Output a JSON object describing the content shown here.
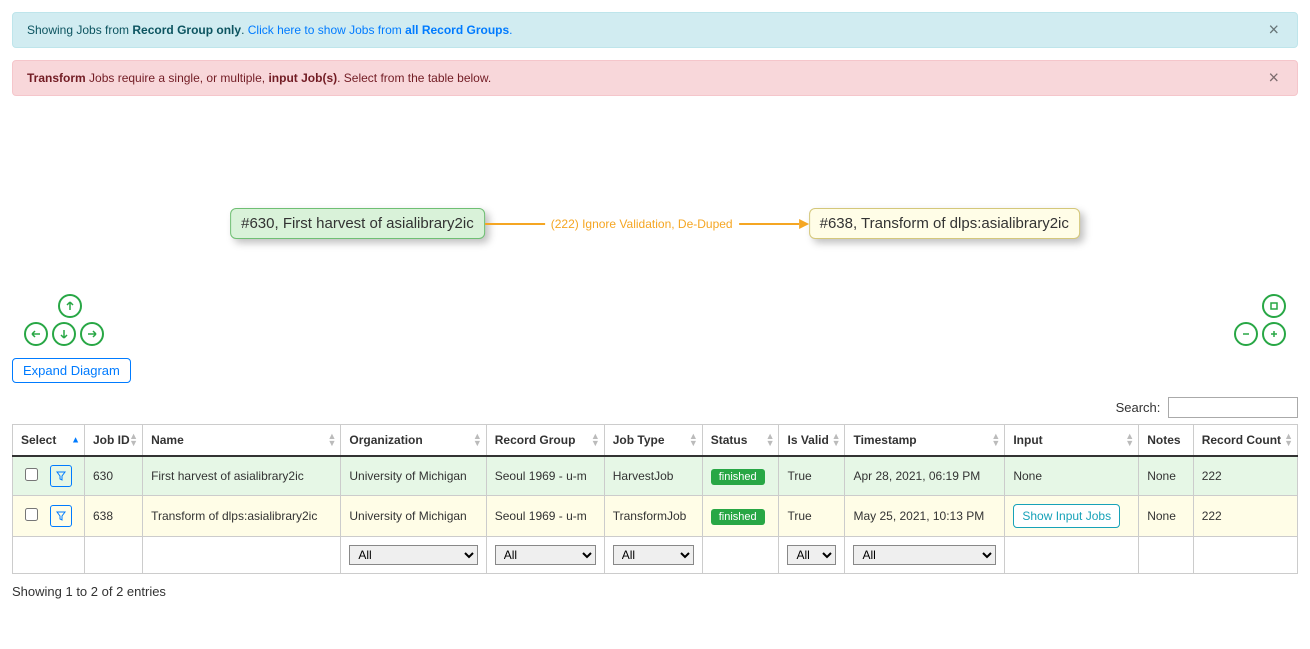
{
  "alerts": {
    "info": {
      "prefix": "Showing Jobs from ",
      "bold1": "Record Group only",
      "dot": ". ",
      "link_prefix": "Click here to show Jobs from ",
      "link_bold": "all Record Groups",
      "link_suffix": "."
    },
    "danger": {
      "bold1": "Transform",
      "mid": " Jobs require a single, or multiple, ",
      "bold2": "input Job(s)",
      "suffix": ". Select from the table below."
    }
  },
  "diagram": {
    "node1": "#630, First harvest of asialibrary2ic",
    "edge": "(222) Ignore Validation, De-Duped",
    "node2": "#638, Transform of dlps:asialibrary2ic"
  },
  "expand_button": "Expand Diagram",
  "search": {
    "label": "Search:",
    "value": ""
  },
  "table": {
    "headers": {
      "select": "Select",
      "job_id": "Job ID",
      "name": "Name",
      "organization": "Organization",
      "record_group": "Record Group",
      "job_type": "Job Type",
      "status": "Status",
      "is_valid": "Is Valid",
      "timestamp": "Timestamp",
      "input": "Input",
      "notes": "Notes",
      "record_count": "Record Count"
    },
    "rows": [
      {
        "job_id": "630",
        "name": "First harvest of asialibrary2ic",
        "organization": "University of Michigan",
        "record_group": "Seoul 1969 - u-m",
        "job_type": "HarvestJob",
        "status": "finished",
        "is_valid": "True",
        "timestamp": "Apr 28, 2021, 06:19 PM",
        "input": "None",
        "notes": "None",
        "record_count": "222"
      },
      {
        "job_id": "638",
        "name": "Transform of dlps:asialibrary2ic",
        "organization": "University of Michigan",
        "record_group": "Seoul 1969 - u-m",
        "job_type": "TransformJob",
        "status": "finished",
        "is_valid": "True",
        "timestamp": "May 25, 2021, 10:13 PM",
        "input_button": "Show Input Jobs",
        "notes": "None",
        "record_count": "222"
      }
    ],
    "footer_filter": "All"
  },
  "entries_info": "Showing 1 to 2 of 2 entries"
}
